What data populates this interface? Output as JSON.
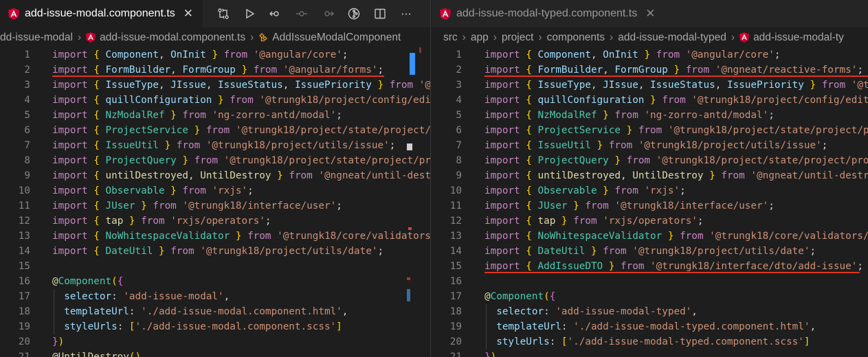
{
  "left": {
    "tab": {
      "title": "add-issue-modal.component.ts",
      "close": "✕"
    },
    "breadcrumb": [
      "dd-issue-modal",
      "add-issue-modal.component.ts",
      "AddIssueModalComponent"
    ],
    "line_numbers": [
      "1",
      "2",
      "3",
      "4",
      "5",
      "6",
      "7",
      "8",
      "9",
      "10",
      "11",
      "12",
      "13",
      "14",
      "15",
      "16",
      "17",
      "18",
      "19",
      "20",
      "21"
    ],
    "lines": {
      "l1": {
        "a": "Component",
        "b": "OnInit",
        "from": "'@angular/core'"
      },
      "l2": {
        "a": "FormBuilder",
        "b": "FormGroup",
        "from": "'@angular/forms'"
      },
      "l3": {
        "a": "IssueType",
        "b": "JIssue",
        "c": "IssueStatus",
        "d": "IssuePriority",
        "from": "'@"
      },
      "l4": {
        "a": "quillConfiguration",
        "from": "'@trungk18/project/config/edi"
      },
      "l5": {
        "a": "NzModalRef",
        "from": "'ng-zorro-antd/modal'"
      },
      "l6": {
        "a": "ProjectService",
        "from": "'@trungk18/project/state/project/"
      },
      "l7": {
        "a": "IssueUtil",
        "from": "'@trungk18/project/utils/issue'"
      },
      "l8": {
        "a": "ProjectQuery",
        "from": "'@trungk18/project/state/project/pr"
      },
      "l9": {
        "a": "untilDestroyed",
        "b": "UntilDestroy",
        "from": "'@ngneat/until-dest"
      },
      "l10": {
        "a": "Observable",
        "from": "'rxjs'"
      },
      "l11": {
        "a": "JUser",
        "from": "'@trungk18/interface/user'"
      },
      "l12": {
        "a": "tap",
        "from": "'rxjs/operators'"
      },
      "l13": {
        "a": "NoWhitespaceValidator",
        "from": "'@trungk18/core/validators"
      },
      "l14": {
        "a": "DateUtil",
        "from": "'@trungk18/project/utils/date'"
      },
      "l16": {
        "decorator": "Component"
      },
      "l17": {
        "key": "selector",
        "val": "'add-issue-modal'"
      },
      "l18": {
        "key": "templateUrl",
        "val": "'./add-issue-modal.component.html'"
      },
      "l19": {
        "key": "styleUrls",
        "val": "'./add-issue-modal.component.scss'"
      },
      "l21": {
        "decorator": "UntilDestroy"
      }
    }
  },
  "right": {
    "tab": {
      "title": "add-issue-modal-typed.component.ts",
      "close": "✕"
    },
    "breadcrumb": [
      "src",
      "app",
      "project",
      "components",
      "add-issue-modal-typed",
      "add-issue-modal-ty"
    ],
    "line_numbers": [
      "1",
      "2",
      "3",
      "4",
      "5",
      "6",
      "7",
      "8",
      "9",
      "10",
      "11",
      "12",
      "13",
      "14",
      "15",
      "16",
      "17",
      "18",
      "19",
      "20",
      "21"
    ],
    "lines": {
      "l1": {
        "a": "Component",
        "b": "OnInit",
        "from": "'@angular/core'"
      },
      "l2": {
        "a": "FormBuilder",
        "b": "FormGroup",
        "from": "'@ngneat/reactive-forms'"
      },
      "l3": {
        "a": "IssueType",
        "b": "JIssue",
        "c": "IssueStatus",
        "d": "IssuePriority",
        "from": "'@t"
      },
      "l4": {
        "a": "quillConfiguration",
        "from": "'@trungk18/project/config/edit"
      },
      "l5": {
        "a": "NzModalRef",
        "from": "'ng-zorro-antd/modal'"
      },
      "l6": {
        "a": "ProjectService",
        "from": "'@trungk18/project/state/project/p"
      },
      "l7": {
        "a": "IssueUtil",
        "from": "'@trungk18/project/utils/issue'"
      },
      "l8": {
        "a": "ProjectQuery",
        "from": "'@trungk18/project/state/project/pro"
      },
      "l9": {
        "a": "untilDestroyed",
        "b": "UntilDestroy",
        "from": "'@ngneat/until-destr"
      },
      "l10": {
        "a": "Observable",
        "from": "'rxjs'"
      },
      "l11": {
        "a": "JUser",
        "from": "'@trungk18/interface/user'"
      },
      "l12": {
        "a": "tap",
        "from": "'rxjs/operators'"
      },
      "l13": {
        "a": "NoWhitespaceValidator",
        "from": "'@trungk18/core/validators/"
      },
      "l14": {
        "a": "DateUtil",
        "from": "'@trungk18/project/utils/date'"
      },
      "l15": {
        "a": "AddIssueDTO",
        "from": "'@trungk18/interface/dto/add-issue'"
      },
      "l17": {
        "decorator": "Component"
      },
      "l18": {
        "key": "selector",
        "val": "'add-issue-modal-typed'"
      },
      "l19": {
        "key": "templateUrl",
        "val": "'./add-issue-modal-typed.component.html'"
      },
      "l20": {
        "key": "styleUrls",
        "val": "'./add-issue-modal-typed.component.scss'"
      }
    }
  },
  "keywords": {
    "import": "import",
    "from": "from"
  },
  "icons": {
    "angular": "angular-icon",
    "compare": "open-changes-icon",
    "run": "run-icon",
    "back": "go-back-icon",
    "commit": "commit-icon",
    "forward": "go-forward-icon",
    "git": "git-icon",
    "split": "split-editor-icon",
    "more": "more-actions-icon",
    "class": "class-symbol-icon"
  },
  "colors": {
    "background": "#1e1e1e",
    "tabbar": "#252526",
    "highlight": "#e0341e",
    "keyword": "#c586c0",
    "string": "#ce9178",
    "identifier": "#9cdcfe",
    "type": "#4ec9b0"
  },
  "more": "···"
}
